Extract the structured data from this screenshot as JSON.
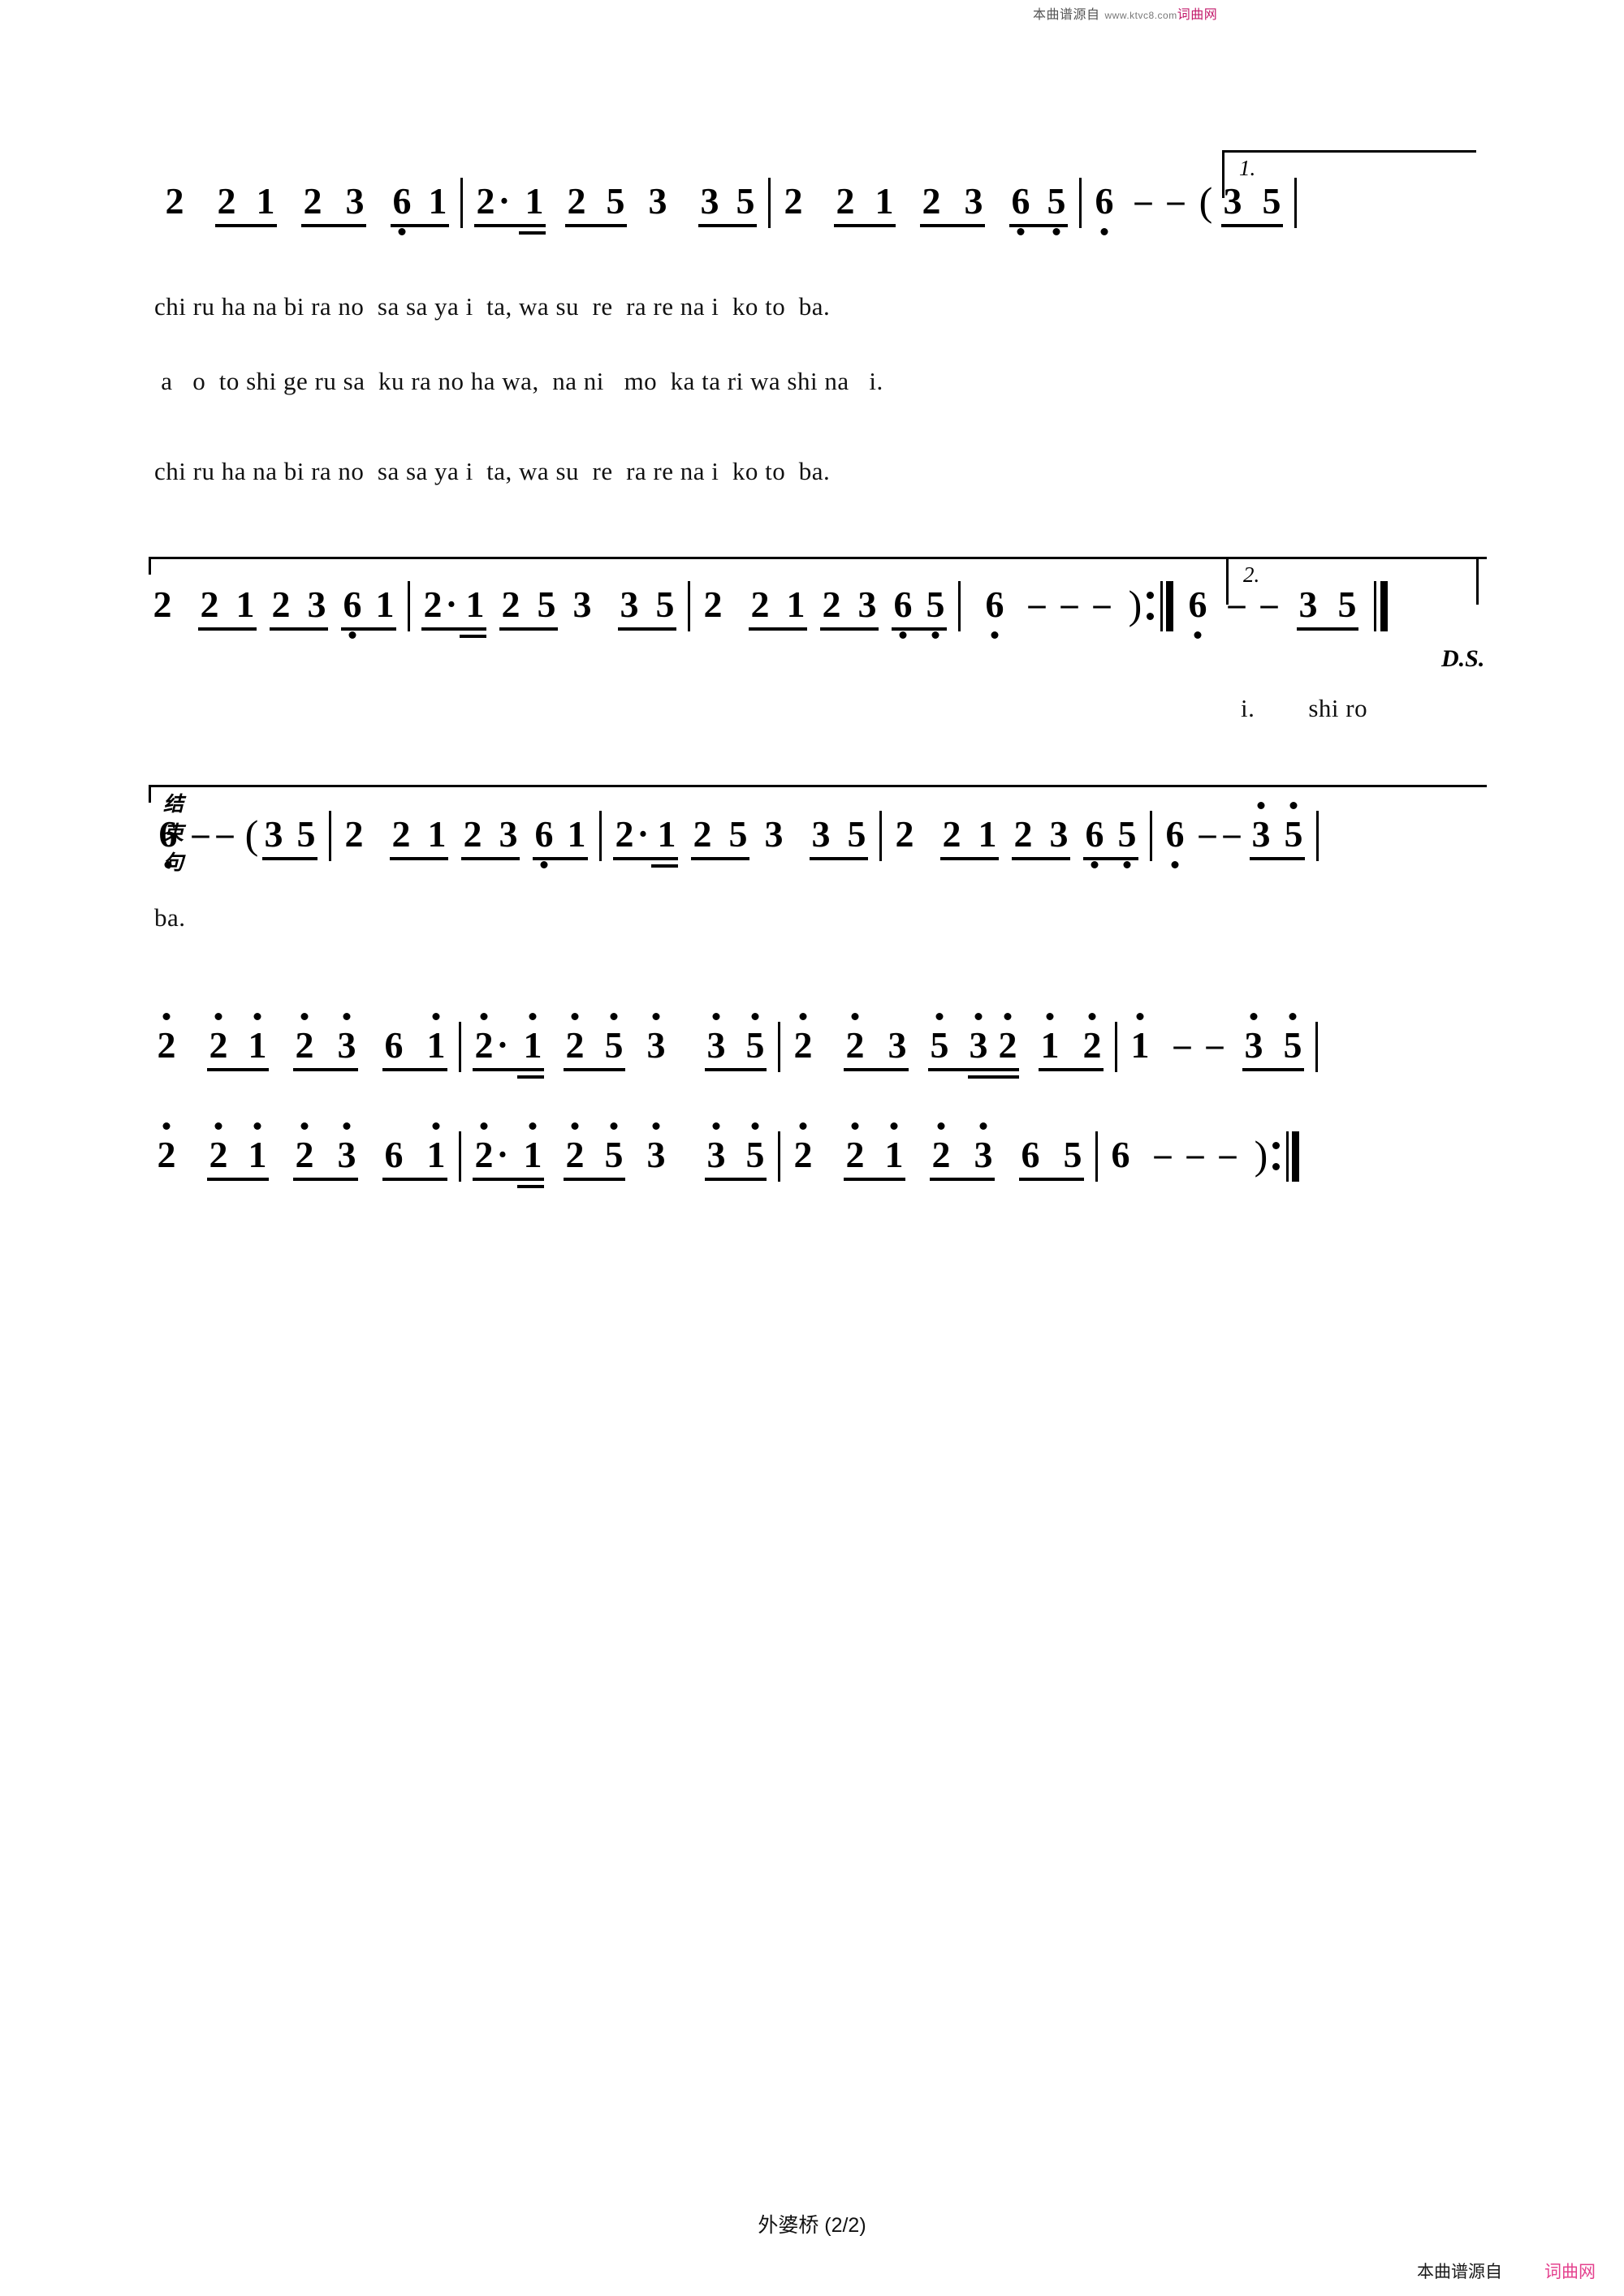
{
  "page": {
    "footer_title": "外婆桥 (2/2)",
    "watermark_top": {
      "label": "本曲谱源自",
      "url": "www.ktvc8.com",
      "site": "词曲网"
    },
    "watermark_bottom": {
      "label": "本曲谱源自",
      "site": "词曲网"
    }
  },
  "markings": {
    "volta1": "1.",
    "volta2": "2.",
    "coda_label": "结束句",
    "ds": "D.S."
  },
  "systems": [
    {
      "id": "system-1",
      "measures": [
        {
          "notes": "2 21 23 6.1"
        },
        {
          "notes": "2·1 25 3 35"
        },
        {
          "notes": "2 21 23 6.5."
        },
        {
          "notes": "6. - - ( 35",
          "volta": "1."
        }
      ],
      "lyrics": [
        "chi ru ha na bi ra no  sa sa ya i  ta, wa su  re  ra re na i  ko to  ba.",
        " a   o  to shi ge ru sa  ku ra no ha wa,  na ni   mo  ka ta ri wa shi na   i.",
        "chi ru ha na bi ra no  sa sa ya i  ta, wa su  re  ra re na i  ko to  ba."
      ]
    },
    {
      "id": "system-2",
      "measures": [
        {
          "notes": "2 21 23 6.1"
        },
        {
          "notes": "2·1 25 3 35"
        },
        {
          "notes": "2 21 23 6.5."
        },
        {
          "notes": "6. - - - ) :||"
        },
        {
          "notes": "6. - - 35 ||",
          "volta": "2."
        }
      ],
      "lyrics": [
        "i.        shi ro"
      ],
      "ds": "D.S."
    },
    {
      "id": "system-3",
      "label": "结束句",
      "measures": [
        {
          "notes": "6. - - ( 35"
        },
        {
          "notes": "2 21 23 6.1"
        },
        {
          "notes": "2·1 25 3 35"
        },
        {
          "notes": "2 21 23 6.5."
        },
        {
          "notes": "6. - - 3'5'"
        }
      ],
      "lyrics": [
        "ba."
      ]
    },
    {
      "id": "system-4",
      "measures": [
        {
          "notes": "2' 2'1' 2'3' 6 1'"
        },
        {
          "notes": "2'·1' 2'5' 3'  3'5'"
        },
        {
          "notes": "2' 2'3' 5'3'2' 1'2'"
        },
        {
          "notes": "1' - - 3'5'"
        }
      ]
    },
    {
      "id": "system-5",
      "measures": [
        {
          "notes": "2' 2'1' 2'3' 6 1'"
        },
        {
          "notes": "2'·1' 2'5' 3'  3'5'"
        },
        {
          "notes": "2' 2'1' 2'3' 6 5"
        },
        {
          "notes": "6 - - - ) :||"
        }
      ]
    }
  ]
}
